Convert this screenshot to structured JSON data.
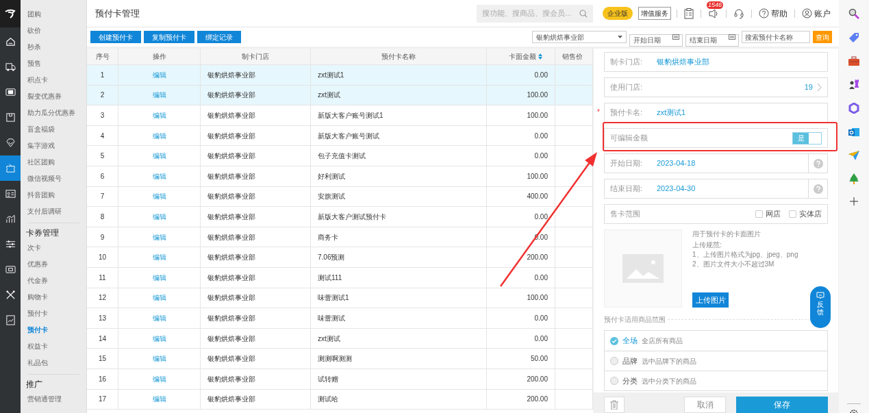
{
  "rail": {
    "items": [
      {
        "selected": false
      },
      {
        "selected": false
      },
      {
        "selected": false
      },
      {
        "selected": false
      },
      {
        "selected": false
      },
      {
        "selected": true
      },
      {
        "selected": false
      },
      {
        "selected": false
      },
      {
        "selected": false
      },
      {
        "selected": false
      },
      {
        "selected": false
      },
      {
        "selected": false
      }
    ]
  },
  "menu": {
    "groups": [
      {
        "items": [
          {
            "label": "团购",
            "selected": false
          },
          {
            "label": "砍价",
            "selected": false
          },
          {
            "label": "秒杀",
            "selected": false
          },
          {
            "label": "预售",
            "selected": false
          },
          {
            "label": "积点卡",
            "selected": false
          },
          {
            "label": "裂变优惠券",
            "selected": false
          },
          {
            "label": "助力瓜分优惠券",
            "selected": false
          },
          {
            "label": "盲盒福袋",
            "selected": false
          },
          {
            "label": "集字游戏",
            "selected": false
          },
          {
            "label": "社区团购",
            "selected": false
          },
          {
            "label": "微信视频号",
            "selected": false
          },
          {
            "label": "抖音团购",
            "selected": false
          },
          {
            "label": "支付后调研",
            "selected": false
          }
        ]
      },
      {
        "heading": "卡券管理",
        "items": [
          {
            "label": "次卡",
            "selected": false
          },
          {
            "label": "优惠券",
            "selected": false
          },
          {
            "label": "代金券",
            "selected": false
          },
          {
            "label": "购物卡",
            "selected": false
          },
          {
            "label": "预付卡",
            "selected": false
          },
          {
            "label": "预付卡",
            "selected": true
          },
          {
            "label": "权益卡",
            "selected": false
          },
          {
            "label": "礼品包",
            "selected": false
          }
        ]
      },
      {
        "heading": "推广",
        "items": [
          {
            "label": "营销通管理",
            "selected": false
          }
        ]
      }
    ]
  },
  "header": {
    "title": "预付卡管理",
    "search_placeholder": "搜功能、搜商品、搜会员...",
    "edition": "企业版",
    "value_added": "增值服务",
    "notification_count": "1546",
    "help": "帮助",
    "account": "账户"
  },
  "toolbar": {
    "buttons": [
      "创建预付卡",
      "复制预付卡",
      "绑定记录"
    ],
    "store": "银豹烘焙事业部",
    "start_placeholder": "开始日期",
    "end_placeholder": "结束日期",
    "search_placeholder": "搜索预付卡名称",
    "query": "查询"
  },
  "table": {
    "columns": [
      "序号",
      "操作",
      "制卡门店",
      "预付卡名称",
      "卡面金额",
      "销售价"
    ],
    "rows": [
      {
        "no": "1",
        "action": "编辑",
        "store": "银豹烘焙事业部",
        "name": "zxt测试1",
        "amount": "0.00",
        "selected": true
      },
      {
        "no": "2",
        "action": "编辑",
        "store": "银豹烘焙事业部",
        "name": "zxt测试",
        "amount": "100.00",
        "selected": true
      },
      {
        "no": "3",
        "action": "编辑",
        "store": "银豹烘焙事业部",
        "name": "新版大客户账号测试1",
        "amount": "100.00",
        "selected": false
      },
      {
        "no": "4",
        "action": "编辑",
        "store": "银豹烘焙事业部",
        "name": "新版大客户账号测试",
        "amount": "0.00",
        "selected": false
      },
      {
        "no": "5",
        "action": "编辑",
        "store": "银豹烘焙事业部",
        "name": "包子充值卡测试",
        "amount": "0.00",
        "selected": false
      },
      {
        "no": "6",
        "action": "编辑",
        "store": "银豹烘焙事业部",
        "name": "好利测试",
        "amount": "100.00",
        "selected": false
      },
      {
        "no": "7",
        "action": "编辑",
        "store": "银豹烘焙事业部",
        "name": "安旗测试",
        "amount": "400.00",
        "selected": false
      },
      {
        "no": "8",
        "action": "编辑",
        "store": "银豹烘焙事业部",
        "name": "新版大客户测试预付卡",
        "amount": "0.00",
        "selected": false
      },
      {
        "no": "9",
        "action": "编辑",
        "store": "银豹烘焙事业部",
        "name": "商务卡",
        "amount": "0.00",
        "selected": false
      },
      {
        "no": "10",
        "action": "编辑",
        "store": "银豹烘焙事业部",
        "name": "7.06预测",
        "amount": "200.00",
        "selected": false
      },
      {
        "no": "11",
        "action": "编辑",
        "store": "银豹烘焙事业部",
        "name": "测试111",
        "amount": "0.00",
        "selected": false
      },
      {
        "no": "12",
        "action": "编辑",
        "store": "银豹烘焙事业部",
        "name": "味蕾测试1",
        "amount": "100.00",
        "selected": false
      },
      {
        "no": "13",
        "action": "编辑",
        "store": "银豹烘焙事业部",
        "name": "味蕾测试",
        "amount": "0.00",
        "selected": false
      },
      {
        "no": "14",
        "action": "编辑",
        "store": "银豹烘焙事业部",
        "name": "zxt测试",
        "amount": "0.00",
        "selected": false
      },
      {
        "no": "15",
        "action": "编辑",
        "store": "银豹烘焙事业部",
        "name": "测测啊测测",
        "amount": "50.00",
        "selected": false
      },
      {
        "no": "16",
        "action": "编辑",
        "store": "银豹烘焙事业部",
        "name": "试转赠",
        "amount": "200.00",
        "selected": false
      },
      {
        "no": "17",
        "action": "编辑",
        "store": "银豹烘焙事业部",
        "name": "测试哈",
        "amount": "200.00",
        "selected": false
      }
    ]
  },
  "panel": {
    "store_label": "制卡门店:",
    "store_value": "银豹烘焙事业部",
    "use_store_label": "使用门店:",
    "use_store_count": "19",
    "required_mark": "*",
    "name_label": "预付卡名:",
    "name_value": "zxt测试1",
    "editable_label": "可编辑金额",
    "editable_toggle": {
      "text": "是",
      "on": true
    },
    "start_label": "开始日期:",
    "start_value": "2023-04-18",
    "end_label": "结束日期:",
    "end_value": "2023-04-30",
    "range_label": "售卡范围",
    "range_options": [
      {
        "label": "网店",
        "checked": false
      },
      {
        "label": "实体店",
        "checked": false
      }
    ],
    "image_hint": "用于预付卡的卡面图片",
    "upload_rules": [
      "上传规范:",
      "1、上传图片格式为jpg、jpeg、png",
      "2、图片文件大小不超过3M"
    ],
    "upload_button": "上传图片",
    "scope_title": "预付卡适用商品范围",
    "scope_options": [
      {
        "label": "全场",
        "desc": "全店所有商品",
        "selected": true
      },
      {
        "label": "品牌",
        "desc": "选中品牌下的商品",
        "selected": false
      },
      {
        "label": "分类",
        "desc": "选中分类下的商品",
        "selected": false
      }
    ],
    "cancel": "取消",
    "save": "保存"
  },
  "feedback": "反馈"
}
